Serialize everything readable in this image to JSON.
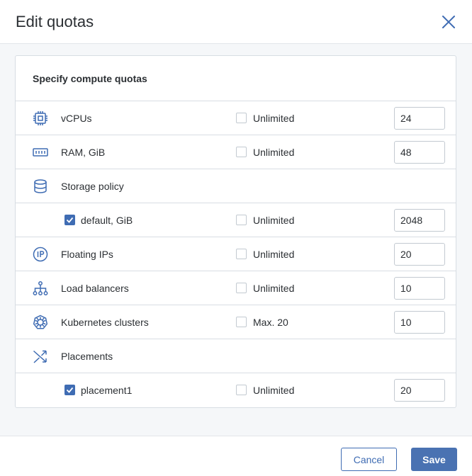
{
  "dialog": {
    "title": "Edit quotas",
    "close_icon": "close-icon"
  },
  "panel": {
    "heading": "Specify compute quotas"
  },
  "rows": {
    "vcpus": {
      "label": "vCPUs",
      "icon": "cpu-icon",
      "unlimited_label": "Unlimited",
      "unlimited_checked": false,
      "value": "24"
    },
    "ram": {
      "label": "RAM, GiB",
      "icon": "memory-icon",
      "unlimited_label": "Unlimited",
      "unlimited_checked": false,
      "value": "48"
    },
    "storage": {
      "label": "Storage policy",
      "icon": "database-icon"
    },
    "storage_default": {
      "label": "default, GiB",
      "checked": true,
      "unlimited_label": "Unlimited",
      "unlimited_checked": false,
      "value": "2048"
    },
    "floating_ips": {
      "label": "Floating IPs",
      "icon": "ip-icon",
      "unlimited_label": "Unlimited",
      "unlimited_checked": false,
      "value": "20"
    },
    "load_balancers": {
      "label": "Load balancers",
      "icon": "network-tree-icon",
      "unlimited_label": "Unlimited",
      "unlimited_checked": false,
      "value": "10"
    },
    "kubernetes": {
      "label": "Kubernetes clusters",
      "icon": "helm-wheel-icon",
      "unlimited_label": "Max. 20",
      "unlimited_checked": false,
      "value": "10"
    },
    "placements": {
      "label": "Placements",
      "icon": "shuffle-icon"
    },
    "placement1": {
      "label": "placement1",
      "checked": true,
      "unlimited_label": "Unlimited",
      "unlimited_checked": false,
      "value": "20"
    }
  },
  "footer": {
    "cancel_label": "Cancel",
    "save_label": "Save"
  },
  "colors": {
    "accent": "#3f6cb3",
    "icon": "#3f6cb3",
    "border": "#d7dde3",
    "body_bg": "#f5f7f9"
  }
}
